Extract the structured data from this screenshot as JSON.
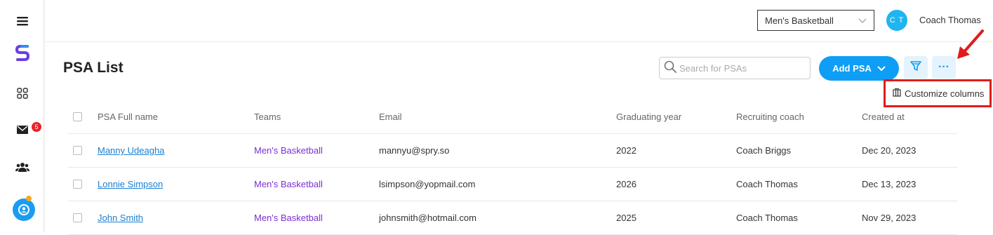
{
  "sidebar": {
    "notification_count": "5"
  },
  "header": {
    "team_selector": "Men's Basketball",
    "user_initials": "C T",
    "user_name": "Coach Thomas"
  },
  "page": {
    "title": "PSA List",
    "search_placeholder": "Search for PSAs",
    "add_button": "Add PSA",
    "more_label": "···",
    "menu_item": "Customize columns"
  },
  "table": {
    "columns": [
      "PSA Full name",
      "Teams",
      "Email",
      "Graduating year",
      "Recruiting coach",
      "Created at"
    ],
    "rows": [
      {
        "name": "Manny Udeagha",
        "team": "Men's Basketball",
        "email": "mannyu@spry.so",
        "year": "2022",
        "coach": "Coach Briggs",
        "created": "Dec 20, 2023"
      },
      {
        "name": "Lonnie Simpson",
        "team": "Men's Basketball",
        "email": "lsimpson@yopmail.com",
        "year": "2026",
        "coach": "Coach Thomas",
        "created": "Dec 13, 2023"
      },
      {
        "name": "John Smith",
        "team": "Men's Basketball",
        "email": "johnsmith@hotmail.com",
        "year": "2025",
        "coach": "Coach Thomas",
        "created": "Nov 29, 2023"
      }
    ]
  },
  "colors": {
    "accent": "#0e9ef5",
    "team_text": "#7b2fd6",
    "highlight": "#e01b1b"
  }
}
